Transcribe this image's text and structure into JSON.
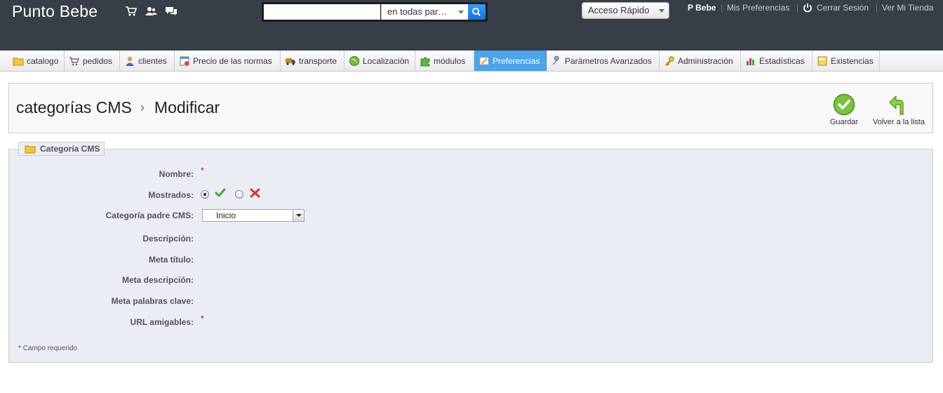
{
  "header": {
    "shop_name": "Punto Bebe",
    "search": {
      "value": "",
      "scope": "en todas par…"
    },
    "quick_access": "Acceso Rápido",
    "user_name": "P Bebe",
    "my_preferences": "Mis Preferencias",
    "logout": "Cerrar Sesión",
    "view_shop": "Ver Mi Tienda",
    "icons": [
      "cart-icon",
      "customers-icon",
      "messages-icon",
      "search-icon",
      "power-icon"
    ]
  },
  "menu": {
    "items": [
      {
        "label": "catalogo",
        "icon": "folder-icon"
      },
      {
        "label": "pedidos",
        "icon": "cart-icon"
      },
      {
        "label": "clientes",
        "icon": "user-icon"
      },
      {
        "label": "Precio de las normas",
        "icon": "price-rules-icon"
      },
      {
        "label": "transporte",
        "icon": "truck-icon"
      },
      {
        "label": "Localización",
        "icon": "globe-icon"
      },
      {
        "label": "módulos",
        "icon": "puzzle-icon"
      },
      {
        "label": "Preferencias",
        "icon": "preferences-icon",
        "active": true
      },
      {
        "label": "Parámetros Avanzados",
        "icon": "wrench-icon"
      },
      {
        "label": "Administración",
        "icon": "key-icon"
      },
      {
        "label": "Estadísticas",
        "icon": "stats-icon"
      },
      {
        "label": "Existencias",
        "icon": "stock-icon"
      }
    ],
    "active_color": "#4ba5e8"
  },
  "toolbar": {
    "title": "categorías CMS",
    "current": "Modificar",
    "save_label": "Guardar",
    "back_label": "Volver a la lista"
  },
  "form": {
    "legend": "Categoría CMS",
    "fields": {
      "name": "Nombre:",
      "displayed": "Mostrados:",
      "parent": "Categoría padre CMS:",
      "description": "Descripción:",
      "meta_title": "Meta título:",
      "meta_description": "Meta descripción:",
      "meta_keywords": "Meta palabras clave:",
      "friendly_url": "URL amigables:"
    },
    "displayed_value": "yes",
    "parent_value": "Inicio",
    "required_mark": "*",
    "required_note": "Campo requerido"
  },
  "colors": {
    "header_bg": "#383e48",
    "fieldset_bg": "#ebedf4",
    "required": "#cc0000"
  }
}
